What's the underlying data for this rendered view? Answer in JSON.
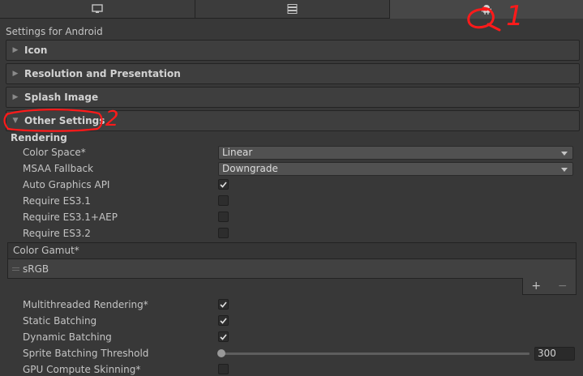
{
  "platform_tabs": [
    {
      "icon": "desktop-icon",
      "selected": false
    },
    {
      "icon": "server-icon",
      "selected": false
    },
    {
      "icon": "android-icon",
      "selected": true
    }
  ],
  "settings_title": "Settings for Android",
  "foldouts": [
    {
      "label": "Icon",
      "expanded": false
    },
    {
      "label": "Resolution and Presentation",
      "expanded": false
    },
    {
      "label": "Splash Image",
      "expanded": false
    },
    {
      "label": "Other Settings",
      "expanded": true
    }
  ],
  "rendering": {
    "heading": "Rendering",
    "color_space": {
      "label": "Color Space*",
      "value": "Linear"
    },
    "msaa_fallback": {
      "label": "MSAA Fallback",
      "value": "Downgrade"
    },
    "auto_graphics_api": {
      "label": "Auto Graphics API",
      "checked": true
    },
    "require_es31": {
      "label": "Require ES3.1",
      "checked": false
    },
    "require_es31_aep": {
      "label": "Require ES3.1+AEP",
      "checked": false
    },
    "require_es32": {
      "label": "Require ES3.2",
      "checked": false
    },
    "color_gamut": {
      "header": "Color Gamut*",
      "items": [
        "sRGB"
      ],
      "add": "+",
      "remove": "−"
    },
    "multithreaded_rendering": {
      "label": "Multithreaded Rendering*",
      "checked": true
    },
    "static_batching": {
      "label": "Static Batching",
      "checked": true
    },
    "dynamic_batching": {
      "label": "Dynamic Batching",
      "checked": true
    },
    "sprite_batching_threshold": {
      "label": "Sprite Batching Threshold",
      "value": "300"
    },
    "gpu_compute_skinning": {
      "label": "GPU Compute Skinning*",
      "checked": false
    }
  },
  "annotations": {
    "mark1": "1",
    "mark2": "2",
    "color": "#ff1a1a"
  },
  "colors": {
    "panel": "#383838",
    "foldout": "#3e3e3e",
    "field": "#515151"
  }
}
